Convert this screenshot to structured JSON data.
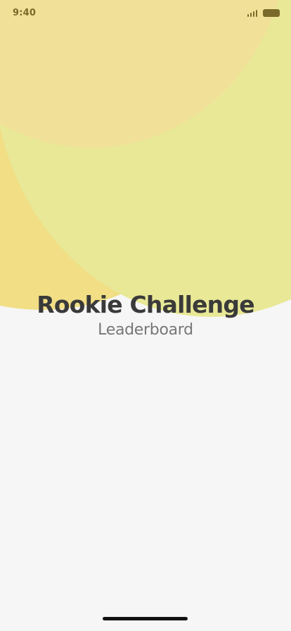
{
  "status_bar": {
    "time": "9:40",
    "signal_icon": "cellular-signal-icon",
    "battery_icon": "battery-icon"
  },
  "header": {
    "title": "Rookie Challenge",
    "subtitle": "Leaderboard"
  },
  "colors": {
    "background": "#f6f6f6",
    "blob_top": "#f1e198",
    "blob_right": "#e8e896",
    "blob_left": "#f1de85",
    "accent_dark": "#7a6a2a",
    "title_text": "#3a3a3a",
    "subtitle_text": "#777777"
  }
}
